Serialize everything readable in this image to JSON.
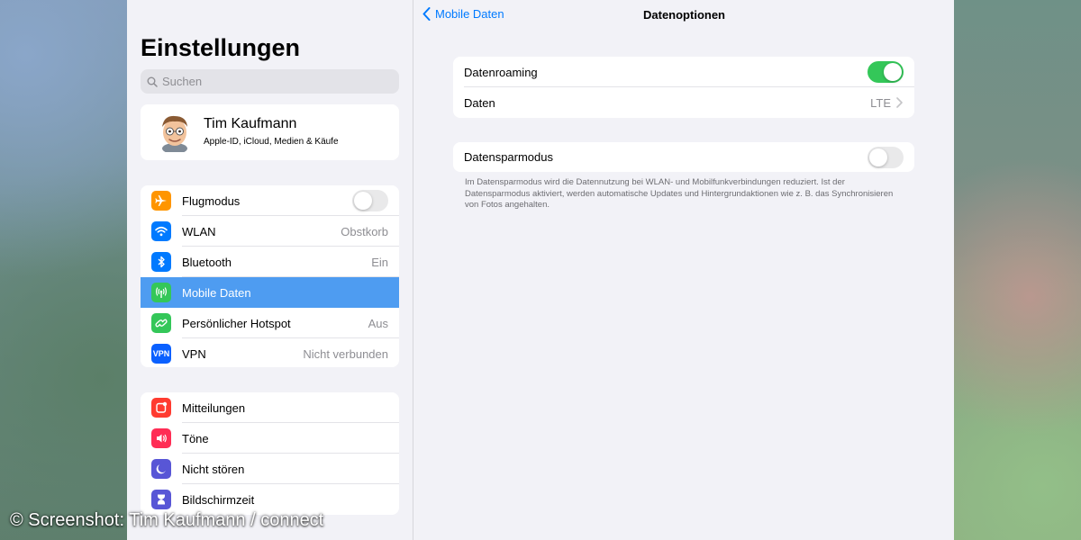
{
  "sidebar": {
    "title": "Einstellungen",
    "search_placeholder": "Suchen",
    "profile": {
      "name": "Tim Kaufmann",
      "subtitle": "Apple-ID, iCloud, Medien & Käufe"
    },
    "group1": [
      {
        "label": "Flugmodus",
        "icon": "airplane-icon",
        "color": "#ff9500",
        "toggle": false
      },
      {
        "label": "WLAN",
        "value": "Obstkorb",
        "icon": "wifi-icon",
        "color": "#007aff"
      },
      {
        "label": "Bluetooth",
        "value": "Ein",
        "icon": "bluetooth-icon",
        "color": "#007aff"
      },
      {
        "label": "Mobile Daten",
        "icon": "antenna-icon",
        "color": "#34c759",
        "selected": true
      },
      {
        "label": "Persönlicher Hotspot",
        "value": "Aus",
        "icon": "hotspot-icon",
        "color": "#34c759"
      },
      {
        "label": "VPN",
        "value": "Nicht verbunden",
        "icon": "vpn-icon",
        "icon_text": "VPN",
        "color": "#0a60ff"
      }
    ],
    "group2": [
      {
        "label": "Mitteilungen",
        "icon": "notifications-icon",
        "color": "#ff3b30"
      },
      {
        "label": "Töne",
        "icon": "speaker-icon",
        "color": "#ff2d55"
      },
      {
        "label": "Nicht stören",
        "icon": "moon-icon",
        "color": "#5856d6"
      },
      {
        "label": "Bildschirmzeit",
        "icon": "hourglass-icon",
        "color": "#5856d6"
      }
    ]
  },
  "detail": {
    "back_label": "Mobile Daten",
    "title": "Datenoptionen",
    "roaming_label": "Datenroaming",
    "roaming_on": true,
    "daten_label": "Daten",
    "daten_value": "LTE",
    "saver_label": "Datensparmodus",
    "saver_on": false,
    "saver_footnote": "Im Datensparmodus wird die Datennutzung bei WLAN- und Mobilfunkverbindungen reduziert. Ist der Datensparmodus aktiviert, werden automatische Updates und Hintergrundaktionen wie z. B. das Synchronisieren von Fotos angehalten."
  },
  "watermark": "© Screenshot: Tim Kaufmann / connect",
  "colors": {
    "accent": "#007aff",
    "toggle_on": "#34c759",
    "selected_row": "#4e9cf1"
  }
}
